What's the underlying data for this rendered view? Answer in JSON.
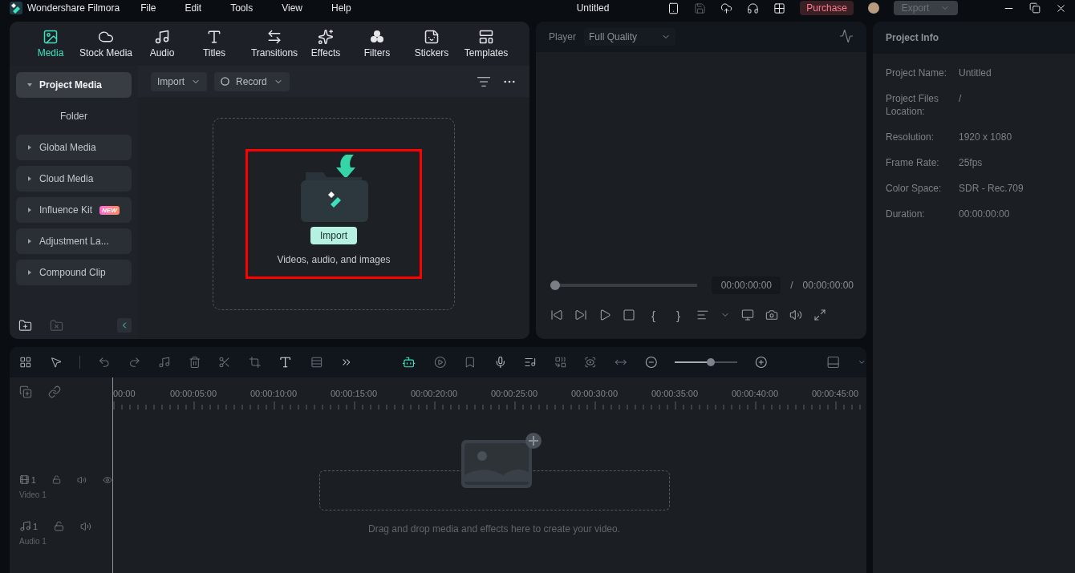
{
  "title_bar": {
    "app_name": "Wondershare Filmora",
    "menu": [
      "File",
      "Edit",
      "Tools",
      "View",
      "Help"
    ],
    "document_title": "Untitled",
    "purchase": "Purchase",
    "export": {
      "label": "Export",
      "disabled": true
    }
  },
  "media_panel": {
    "tabs": [
      {
        "kind": "media",
        "label": "Media",
        "selected": true
      },
      {
        "kind": "stock",
        "label": "Stock Media",
        "selected": false
      },
      {
        "kind": "audio",
        "label": "Audio",
        "selected": false
      },
      {
        "kind": "titles",
        "label": "Titles",
        "selected": false
      },
      {
        "kind": "transitions",
        "label": "Transitions",
        "selected": false
      },
      {
        "kind": "effects",
        "label": "Effects",
        "selected": false
      },
      {
        "kind": "filters",
        "label": "Filters",
        "selected": false
      },
      {
        "kind": "stickers",
        "label": "Stickers",
        "selected": false
      },
      {
        "kind": "templates",
        "label": "Templates",
        "selected": false
      }
    ],
    "sidebar": {
      "items": [
        {
          "label": "Project Media",
          "expanded": true,
          "selected": true,
          "children": [
            {
              "label": "Folder",
              "selected": false
            }
          ]
        },
        {
          "label": "Global Media",
          "expanded": false,
          "selected": false
        },
        {
          "label": "Cloud Media",
          "expanded": false,
          "selected": false
        },
        {
          "label": "Influence Kit",
          "expanded": false,
          "selected": false,
          "badge": "NEW"
        },
        {
          "label": "Adjustment La...",
          "expanded": false,
          "selected": false
        },
        {
          "label": "Compound Clip",
          "expanded": false,
          "selected": false
        }
      ]
    },
    "toolbar": {
      "import": "Import",
      "record": "Record"
    },
    "dropzone": {
      "button": "Import",
      "caption": "Videos, audio, and images",
      "highlighted": true
    }
  },
  "player": {
    "label": "Player",
    "quality": "Full Quality",
    "progress": {
      "level": 0
    },
    "current_time": "00:00:00:00",
    "separator": "/",
    "total_time": "00:00:00:00",
    "mark_in": "{",
    "mark_out": "}"
  },
  "project_info": {
    "title": "Project Info",
    "fields": [
      {
        "label": "Project Name:",
        "value": "Untitled"
      },
      {
        "label": "Project Files Location:",
        "value": "/"
      },
      {
        "label": "Resolution:",
        "value": "1920 x 1080"
      },
      {
        "label": "Frame Rate:",
        "value": "25fps"
      },
      {
        "label": "Color Space:",
        "value": "SDR - Rec.709"
      },
      {
        "label": "Duration:",
        "value": "00:00:00:00"
      }
    ]
  },
  "timeline": {
    "zoom": {
      "level": 0.58
    },
    "ruler": [
      "00:00",
      "00:00:05:00",
      "00:00:10:00",
      "00:00:15:00",
      "00:00:20:00",
      "00:00:25:00",
      "00:00:30:00",
      "00:00:35:00",
      "00:00:40:00",
      "00:00:45:00"
    ],
    "tracks": [
      {
        "kind": "video",
        "number": "1",
        "name": "Video 1"
      },
      {
        "kind": "audio",
        "number": "1",
        "name": "Audio 1"
      }
    ],
    "drop_hint": "Drag and drop media and effects here to create your video."
  }
}
